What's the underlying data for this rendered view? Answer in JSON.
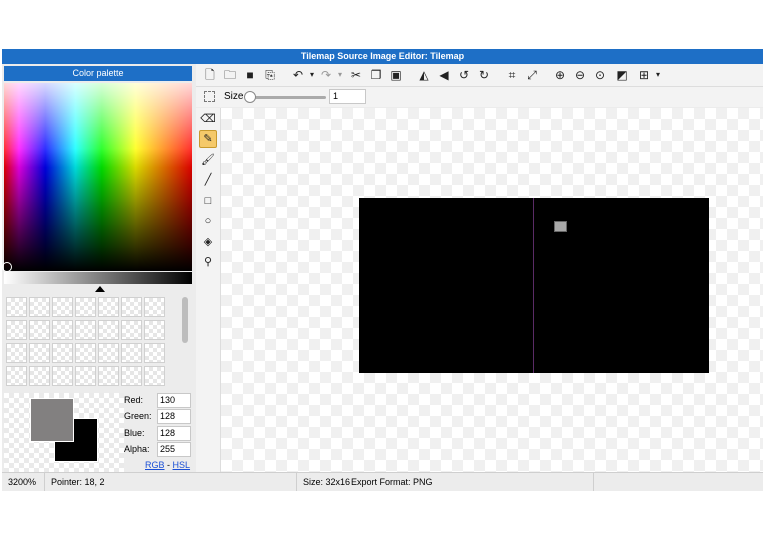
{
  "window": {
    "title": "Tilemap Source Image Editor: Tilemap"
  },
  "palette": {
    "header": "Color palette",
    "rgb": {
      "red_label": "Red:",
      "red": "130",
      "green_label": "Green:",
      "green": "128",
      "blue_label": "Blue:",
      "blue": "128",
      "alpha_label": "Alpha:",
      "alpha": "255"
    },
    "links": {
      "rgb": "RGB",
      "sep": " - ",
      "hsl": "HSL"
    },
    "foreground_color": "#828080",
    "background_color": "#000000"
  },
  "toolbar": {
    "icons": [
      "new-icon",
      "open-icon",
      "save-icon",
      "export-icon",
      "undo-icon",
      "redo-icon",
      "cut-icon",
      "copy-icon",
      "paste-icon",
      "flip-horizontal-icon",
      "flip-vertical-icon",
      "rotate-ccw-icon",
      "rotate-cw-icon",
      "crop-icon",
      "resize-icon",
      "zoom-in-icon",
      "zoom-out-icon",
      "zoom-fit-icon",
      "toggle-background-icon",
      "grid-icon"
    ]
  },
  "subtoolbar": {
    "size_label": "Size",
    "size_value": "1"
  },
  "tools": [
    "eraser-icon",
    "pencil-icon",
    "brush-icon",
    "line-icon",
    "rectangle-icon",
    "ellipse-icon",
    "fill-icon",
    "eyedropper-icon"
  ],
  "active_tool": "pencil-icon",
  "statusbar": {
    "zoom": "3200%",
    "pointer": "Pointer: 18, 2",
    "size": "Size: 32x16",
    "export_format": "Export Format: PNG"
  },
  "colors": {
    "accent": "#1e6fc6",
    "active_tool": "#f5c96a"
  }
}
